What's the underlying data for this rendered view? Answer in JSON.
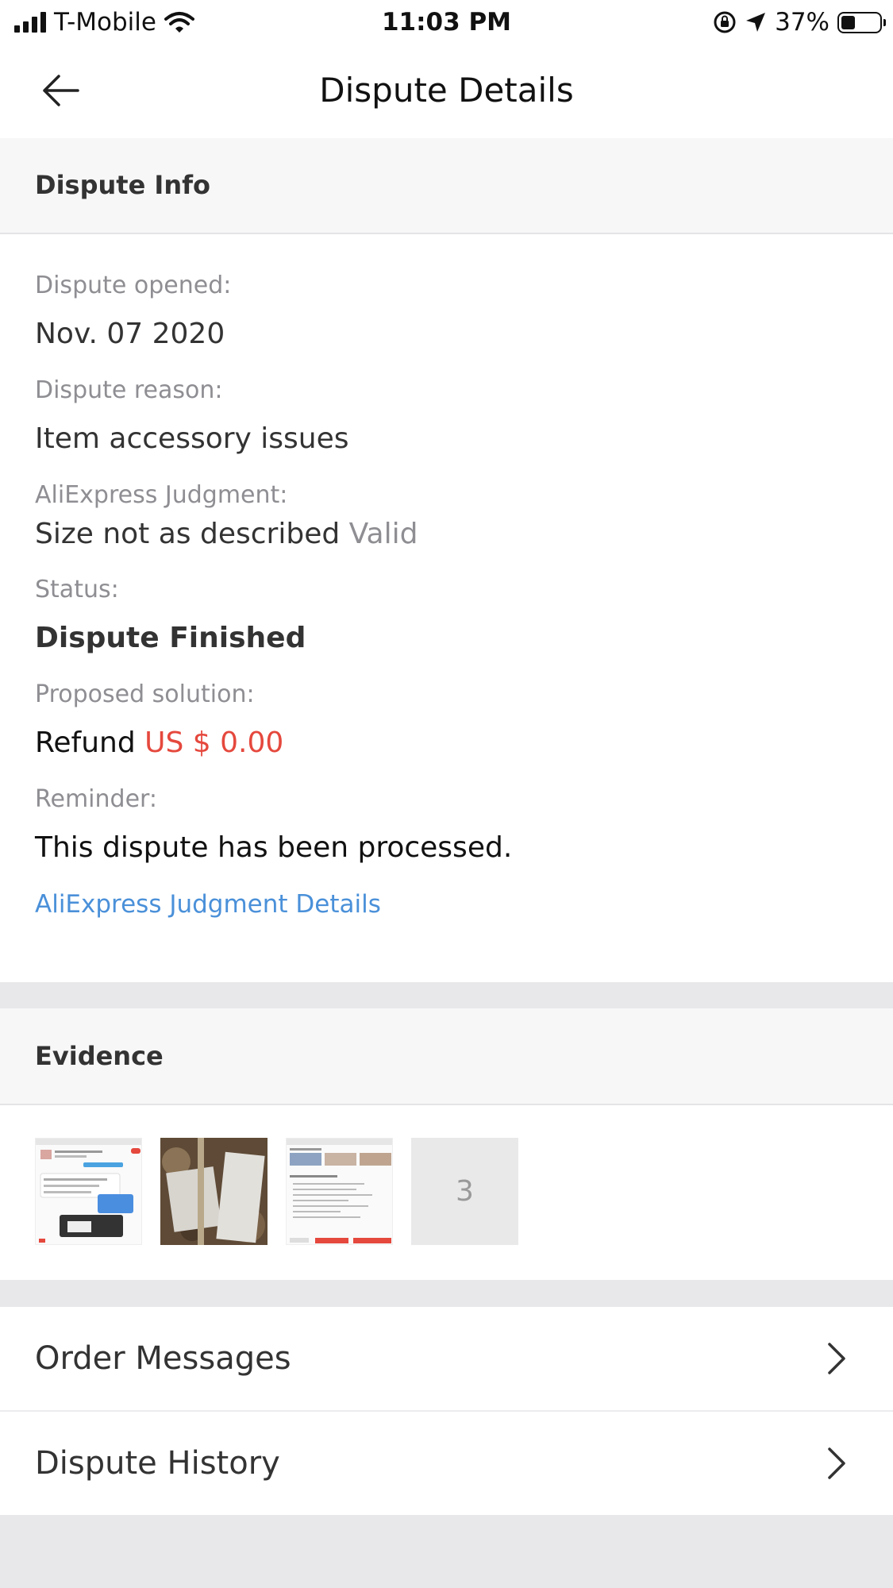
{
  "status_bar": {
    "carrier": "T-Mobile",
    "time": "11:03 PM",
    "battery_percent": "37%",
    "battery_level": 0.37
  },
  "nav": {
    "title": "Dispute Details"
  },
  "dispute_info": {
    "header": "Dispute Info",
    "opened_label": "Dispute opened:",
    "opened_value": "Nov. 07 2020",
    "reason_label": "Dispute reason:",
    "reason_value": "Item accessory issues",
    "judgment_label": "AliExpress Judgment:",
    "judgment_value": "Size not as described",
    "judgment_status": "Valid",
    "status_label": "Status:",
    "status_value": "Dispute Finished",
    "solution_label": "Proposed solution:",
    "solution_prefix": "Refund",
    "solution_amount": "US $ 0.00",
    "reminder_label": "Reminder:",
    "reminder_value": "This dispute has been processed.",
    "judgment_link": "AliExpress Judgment Details"
  },
  "evidence": {
    "header": "Evidence",
    "more_count": "3"
  },
  "rows": {
    "order_messages": "Order Messages",
    "dispute_history": "Dispute History"
  },
  "colors": {
    "accent_link": "#4a90d9",
    "price_red": "#e5483d",
    "label_grey": "#8e8e93"
  }
}
